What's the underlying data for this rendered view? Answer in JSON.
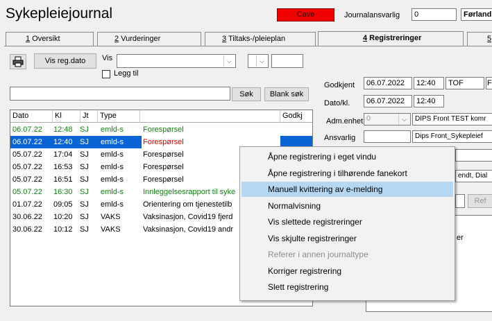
{
  "app": {
    "title": "Sykepleiejournal",
    "cave": "Cave"
  },
  "journal": {
    "label": "Journalansvarlig",
    "number": "0",
    "name": "Førland, T"
  },
  "tabs": [
    {
      "key": "1",
      "label": " Oversikt"
    },
    {
      "key": "2",
      "label": " Vurderinger"
    },
    {
      "key": "3",
      "label": " Tiltaks-/pleieplan"
    },
    {
      "key": "4",
      "label": " Registreringer"
    },
    {
      "key": "5",
      "label": ""
    }
  ],
  "toolbar": {
    "print_icon": "printer-icon",
    "vis_reg_label": "Vis reg.dato",
    "vis_label": "Vis",
    "legg_til_label": "Legg til"
  },
  "search": {
    "value": "",
    "search_btn": "Søk",
    "blank_btn": "Blank søk"
  },
  "list": {
    "headers": [
      "Dato",
      "Kl",
      "Jt",
      "Type",
      "",
      "Godkj"
    ],
    "rows": [
      {
        "dato": "06.07.22",
        "kl": "12:48",
        "jt": "SJ",
        "type": "emld-s",
        "desc": "Forespørsel",
        "style": "green"
      },
      {
        "dato": "06.07.22",
        "kl": "12:40",
        "jt": "SJ",
        "type": "emld-s",
        "desc": "Forespørsel",
        "style": "selected"
      },
      {
        "dato": "05.07.22",
        "kl": "17:04",
        "jt": "SJ",
        "type": "emld-s",
        "desc": "Forespørsel",
        "style": "normal"
      },
      {
        "dato": "05.07.22",
        "kl": "16:53",
        "jt": "SJ",
        "type": "emld-s",
        "desc": "Forespørsel",
        "style": "normal"
      },
      {
        "dato": "05.07.22",
        "kl": "16:51",
        "jt": "SJ",
        "type": "emld-s",
        "desc": "Forespørsel",
        "style": "normal"
      },
      {
        "dato": "05.07.22",
        "kl": "16:30",
        "jt": "SJ",
        "type": "emld-s",
        "desc": "Innleggelsesrapport til syke",
        "style": "green"
      },
      {
        "dato": "01.07.22",
        "kl": "09:05",
        "jt": "SJ",
        "type": "emld-s",
        "desc": "Orientering om tjenestetilb",
        "style": "normal"
      },
      {
        "dato": "30.06.22",
        "kl": "10:20",
        "jt": "SJ",
        "type": "VAKS",
        "desc": "Vaksinasjon, Covid19 fjerd",
        "style": "normal"
      },
      {
        "dato": "30.06.22",
        "kl": "10:12",
        "jt": "SJ",
        "type": "VAKS",
        "desc": "Vaksinasjon, Covid19 andr",
        "style": "normal"
      }
    ]
  },
  "detail": {
    "godkjent_label": "Godkjent",
    "godkjent_date": "06.07.2022",
    "godkjent_time": "12:40",
    "godkjent_user": "TOF",
    "godkjent_extra": "F",
    "dato_label": "Dato/kl.",
    "dato_date": "06.07.2022",
    "dato_time": "12:40",
    "adm_label": "Adm.enhet",
    "adm_value": "0",
    "adm_name": "DIPS Front TEST komr",
    "ansvarlig_label": "Ansvarlig",
    "ansvarlig_name": "Dips Front_Sykepleief",
    "partial_1": "endt, Dial",
    "partial_btn": "Ref",
    "partial_2": "er"
  },
  "menu": {
    "items": [
      {
        "label": "Åpne registrering i eget vindu",
        "state": "normal"
      },
      {
        "label": "Åpne registrering i tilhørende fanekort",
        "state": "normal"
      },
      {
        "label": "Manuell kvittering av e-melding",
        "state": "highlight"
      },
      {
        "label": "Normalvisning",
        "state": "normal"
      },
      {
        "label": "Vis slettede registreringer",
        "state": "normal"
      },
      {
        "label": "Vis skjulte registreringer",
        "state": "normal"
      },
      {
        "label": "Referer i annen journaltype",
        "state": "disabled"
      },
      {
        "label": "Korriger registrering",
        "state": "normal"
      },
      {
        "label": "Slett registrering",
        "state": "normal"
      }
    ]
  },
  "colors": {
    "selection": "#0a64d6",
    "green": "#128012",
    "red": "#e00000",
    "cave": "#f00000",
    "menu_highlight": "#b5d7f2"
  }
}
